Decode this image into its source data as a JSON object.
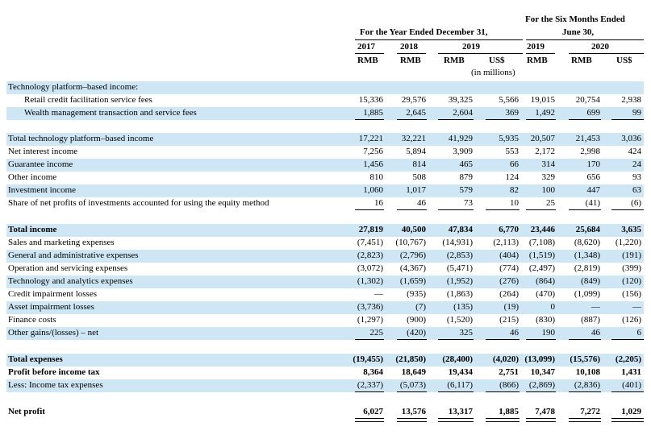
{
  "header": {
    "year_group": "For the Year Ended December 31,",
    "six_month_line1": "For the Six Months Ended",
    "six_month_line2": "June 30,",
    "years": [
      "2017",
      "2018",
      "2019",
      "2019",
      "2020"
    ],
    "currencies": [
      "RMB",
      "RMB",
      "RMB",
      "US$",
      "RMB",
      "RMB",
      "US$"
    ],
    "in_millions": "(in millions)"
  },
  "rows": [
    {
      "label": "Technology platform–based income:",
      "values": [
        "",
        "",
        "",
        "",
        "",
        "",
        ""
      ],
      "shaded": true,
      "indent": false,
      "bold": false
    },
    {
      "label": "Retail credit facilitation service fees",
      "values": [
        "15,336",
        "29,576",
        "39,325",
        "5,566",
        "19,015",
        "20,754",
        "2,938"
      ],
      "shaded": false,
      "indent": true,
      "bold": false
    },
    {
      "label": "Wealth management transaction and service fees",
      "values": [
        "1,885",
        "2,645",
        "2,604",
        "369",
        "1,492",
        "699",
        "99"
      ],
      "shaded": true,
      "indent": true,
      "bold": false
    },
    {
      "label": "Total technology platform–based income",
      "values": [
        "17,221",
        "32,221",
        "41,929",
        "5,935",
        "20,507",
        "21,453",
        "3,036"
      ],
      "shaded": true,
      "indent": false,
      "bold": false
    },
    {
      "label": "Net interest income",
      "values": [
        "7,256",
        "5,894",
        "3,909",
        "553",
        "2,172",
        "2,998",
        "424"
      ],
      "shaded": false,
      "indent": false,
      "bold": false
    },
    {
      "label": "Guarantee income",
      "values": [
        "1,456",
        "814",
        "465",
        "66",
        "314",
        "170",
        "24"
      ],
      "shaded": true,
      "indent": false,
      "bold": false
    },
    {
      "label": "Other income",
      "values": [
        "810",
        "508",
        "879",
        "124",
        "329",
        "656",
        "93"
      ],
      "shaded": false,
      "indent": false,
      "bold": false
    },
    {
      "label": "Investment income",
      "values": [
        "1,060",
        "1,017",
        "579",
        "82",
        "100",
        "447",
        "63"
      ],
      "shaded": true,
      "indent": false,
      "bold": false
    },
    {
      "label": "Share of net profits of investments accounted for using the equity method",
      "values": [
        "16",
        "46",
        "73",
        "10",
        "25",
        "(41)",
        "(6)"
      ],
      "shaded": false,
      "indent": false,
      "bold": false
    },
    {
      "label": "Total income",
      "values": [
        "27,819",
        "40,500",
        "47,834",
        "6,770",
        "23,446",
        "25,684",
        "3,635"
      ],
      "shaded": true,
      "indent": false,
      "bold": true
    },
    {
      "label": "Sales and marketing expenses",
      "values": [
        "(7,451)",
        "(10,767)",
        "(14,931)",
        "(2,113)",
        "(7,108)",
        "(8,620)",
        "(1,220)"
      ],
      "shaded": false,
      "indent": false,
      "bold": false
    },
    {
      "label": "General and administrative expenses",
      "values": [
        "(2,823)",
        "(2,796)",
        "(2,853)",
        "(404)",
        "(1,519)",
        "(1,348)",
        "(191)"
      ],
      "shaded": true,
      "indent": false,
      "bold": false
    },
    {
      "label": "Operation and servicing expenses",
      "values": [
        "(3,072)",
        "(4,367)",
        "(5,471)",
        "(774)",
        "(2,497)",
        "(2,819)",
        "(399)"
      ],
      "shaded": false,
      "indent": false,
      "bold": false
    },
    {
      "label": "Technology and analytics expenses",
      "values": [
        "(1,302)",
        "(1,659)",
        "(1,952)",
        "(276)",
        "(864)",
        "(849)",
        "(120)"
      ],
      "shaded": true,
      "indent": false,
      "bold": false
    },
    {
      "label": "Credit impairment losses",
      "values": [
        "—",
        "(935)",
        "(1,863)",
        "(264)",
        "(470)",
        "(1,099)",
        "(156)"
      ],
      "shaded": false,
      "indent": false,
      "bold": false
    },
    {
      "label": "Asset impairment losses",
      "values": [
        "(3,736)",
        "(7)",
        "(135)",
        "(19)",
        "0",
        "—",
        "—"
      ],
      "shaded": true,
      "indent": false,
      "bold": false
    },
    {
      "label": "Finance costs",
      "values": [
        "(1,297)",
        "(900)",
        "(1,520)",
        "(215)",
        "(830)",
        "(887)",
        "(126)"
      ],
      "shaded": false,
      "indent": false,
      "bold": false
    },
    {
      "label": "Other gains/(losses) – net",
      "values": [
        "225",
        "(420)",
        "325",
        "46",
        "190",
        "46",
        "6"
      ],
      "shaded": true,
      "indent": false,
      "bold": false
    },
    {
      "label": "Total expenses",
      "values": [
        "(19,455)",
        "(21,850)",
        "(28,400)",
        "(4,020)",
        "(13,099)",
        "(15,576)",
        "(2,205)"
      ],
      "shaded": true,
      "indent": false,
      "bold": true
    },
    {
      "label": "Profit before income tax",
      "values": [
        "8,364",
        "18,649",
        "19,434",
        "2,751",
        "10,347",
        "10,108",
        "1,431"
      ],
      "shaded": false,
      "indent": false,
      "bold": true
    },
    {
      "label": "Less: Income tax expenses",
      "values": [
        "(2,337)",
        "(5,073)",
        "(6,117)",
        "(866)",
        "(2,869)",
        "(2,836)",
        "(401)"
      ],
      "shaded": true,
      "indent": false,
      "bold": false
    },
    {
      "label": "Net profit",
      "values": [
        "6,027",
        "13,576",
        "13,317",
        "1,885",
        "7,478",
        "7,272",
        "1,029"
      ],
      "shaded": false,
      "indent": false,
      "bold": true
    }
  ]
}
